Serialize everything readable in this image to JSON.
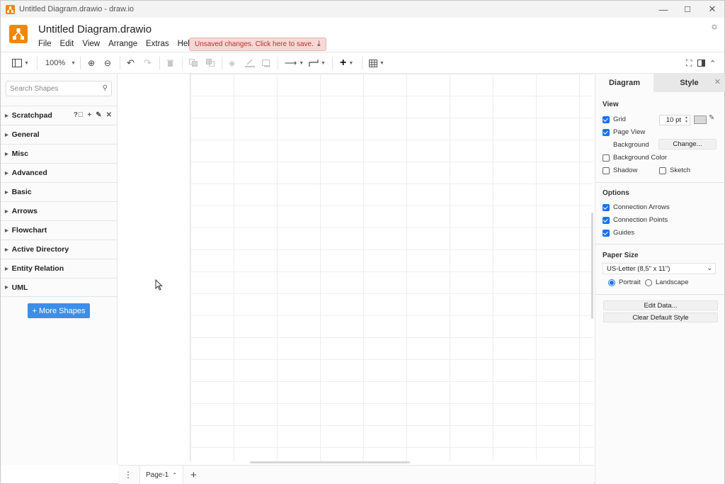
{
  "window": {
    "title": "Untitled Diagram.drawio - draw.io",
    "minimize": "—",
    "maximize": "☐",
    "close": "✕"
  },
  "header": {
    "doc_title": "Untitled Diagram.drawio",
    "menu": [
      "File",
      "Edit",
      "View",
      "Arrange",
      "Extras",
      "Help"
    ],
    "unsaved_notice": "Unsaved changes. Click here to save."
  },
  "toolbar": {
    "zoom": "100%"
  },
  "sidebar": {
    "search_placeholder": "Search Shapes",
    "libraries": [
      "Scratchpad",
      "General",
      "Misc",
      "Advanced",
      "Basic",
      "Arrows",
      "Flowchart",
      "Active Directory",
      "Entity Relation",
      "UML"
    ],
    "more_shapes": "+ More Shapes"
  },
  "pages": {
    "current": "Page-1"
  },
  "format_panel": {
    "tabs": [
      "Diagram",
      "Style"
    ],
    "view_section": "View",
    "grid_label": "Grid",
    "grid_size": "10 pt",
    "page_view_label": "Page View",
    "background_label": "Background",
    "change_button": "Change...",
    "background_color_label": "Background Color",
    "shadow_label": "Shadow",
    "sketch_label": "Sketch",
    "options_section": "Options",
    "connection_arrows_label": "Connection Arrows",
    "connection_points_label": "Connection Points",
    "guides_label": "Guides",
    "paper_size_section": "Paper Size",
    "paper_size_value": "US-Letter (8,5\" x 11\")",
    "portrait_label": "Portrait",
    "landscape_label": "Landscape",
    "edit_data_button": "Edit Data...",
    "clear_style_button": "Clear Default Style"
  }
}
